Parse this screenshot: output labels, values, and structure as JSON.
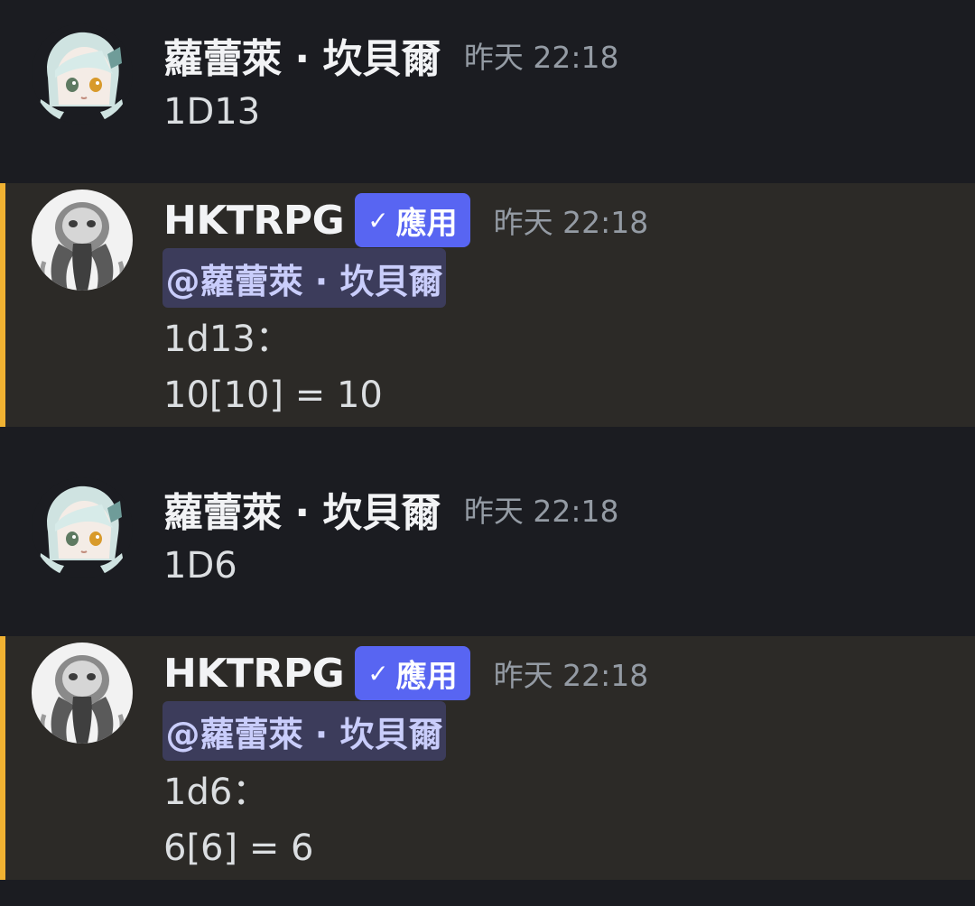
{
  "messages": [
    {
      "author": "蘿蕾萊 · 坎貝爾",
      "time": "昨天 22:18",
      "lines": [
        "1D13"
      ],
      "avatar": "anime-girl-avatar"
    },
    {
      "author": "HKTRPG",
      "badge": {
        "check": "✓",
        "label": "應用"
      },
      "time": "昨天 22:18",
      "mention": "@蘿蕾萊 · 坎貝爾",
      "lines": [
        "1d13：",
        "10[10] = 10"
      ],
      "avatar": "octopus-mask-avatar",
      "highlight_color": "#f0b232"
    },
    {
      "author": "蘿蕾萊 · 坎貝爾",
      "time": "昨天 22:18",
      "lines": [
        "1D6"
      ],
      "avatar": "anime-girl-avatar"
    },
    {
      "author": "HKTRPG",
      "badge": {
        "check": "✓",
        "label": "應用"
      },
      "time": "昨天 22:18",
      "mention": "@蘿蕾萊 · 坎貝爾",
      "lines": [
        "1d6：",
        "6[6] = 6"
      ],
      "avatar": "octopus-mask-avatar",
      "highlight_color": "#f0b232"
    }
  ],
  "colors": {
    "background": "#1b1c21",
    "mention_background": "#2c2a27",
    "badge": "#5865f2",
    "mention_pill": "#3c3c5b"
  }
}
